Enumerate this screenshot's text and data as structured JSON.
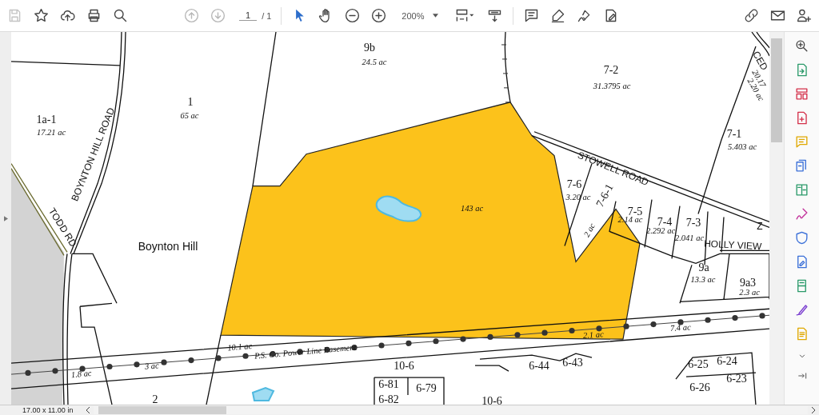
{
  "toolbar": {
    "page_number": "1",
    "page_total": "/ 1",
    "zoom": "200%"
  },
  "map": {
    "labels": [
      {
        "text": "9b",
        "kind": "parcel"
      },
      {
        "text": "24.5 ac",
        "kind": "area"
      },
      {
        "text": "7-2",
        "kind": "parcel"
      },
      {
        "text": "31.3795 ac",
        "kind": "area"
      },
      {
        "text": "CED",
        "kind": "road"
      },
      {
        "text": "20.17",
        "kind": "area"
      },
      {
        "text": "2.20 ac",
        "kind": "area"
      },
      {
        "text": "1a-1",
        "kind": "parcel"
      },
      {
        "text": "17.21 ac",
        "kind": "area"
      },
      {
        "text": "1",
        "kind": "parcel"
      },
      {
        "text": "65 ac",
        "kind": "area"
      },
      {
        "text": "7-1",
        "kind": "parcel"
      },
      {
        "text": "5.403 ac",
        "kind": "area"
      },
      {
        "text": "BOYNTON HILL ROAD",
        "kind": "road"
      },
      {
        "text": "STOWELL ROAD",
        "kind": "road"
      },
      {
        "text": "7-6",
        "kind": "parcel"
      },
      {
        "text": "3.20 ac",
        "kind": "area"
      },
      {
        "text": "7-6-1",
        "kind": "parcel"
      },
      {
        "text": "143 ac",
        "kind": "area"
      },
      {
        "text": "7-5",
        "kind": "parcel"
      },
      {
        "text": "2.14 ac",
        "kind": "area"
      },
      {
        "text": "7-4",
        "kind": "parcel"
      },
      {
        "text": "2.292 ac",
        "kind": "area"
      },
      {
        "text": "7-3",
        "kind": "parcel"
      },
      {
        "text": "2.041 ac",
        "kind": "area"
      },
      {
        "text": "Z",
        "kind": "road"
      },
      {
        "text": "2 ac",
        "kind": "area"
      },
      {
        "text": "TODD RD",
        "kind": "road"
      },
      {
        "text": "Boynton Hill",
        "kind": "place"
      },
      {
        "text": "HOLLY VIEW",
        "kind": "road"
      },
      {
        "text": "9a",
        "kind": "parcel"
      },
      {
        "text": "13.3 ac",
        "kind": "area"
      },
      {
        "text": "9a3",
        "kind": "parcel"
      },
      {
        "text": "2.3 ac",
        "kind": "area"
      },
      {
        "text": "7.4 ac",
        "kind": "area"
      },
      {
        "text": "2.1 ac",
        "kind": "area"
      },
      {
        "text": "10.1 ac",
        "kind": "area"
      },
      {
        "text": "P.S. Co. Power Line Easement",
        "kind": "area"
      },
      {
        "text": "3 ac",
        "kind": "area"
      },
      {
        "text": "1.8 ac",
        "kind": "area"
      },
      {
        "text": "10-6",
        "kind": "parcel"
      },
      {
        "text": "6-44",
        "kind": "parcel"
      },
      {
        "text": "6-43",
        "kind": "parcel"
      },
      {
        "text": "6-25",
        "kind": "parcel"
      },
      {
        "text": "6-24",
        "kind": "parcel"
      },
      {
        "text": "6-81",
        "kind": "parcel"
      },
      {
        "text": "6-79",
        "kind": "parcel"
      },
      {
        "text": "6-26",
        "kind": "parcel"
      },
      {
        "text": "6-23",
        "kind": "parcel"
      },
      {
        "text": "2",
        "kind": "parcel"
      },
      {
        "text": "6-82",
        "kind": "parcel"
      },
      {
        "text": "10-6",
        "kind": "parcel"
      }
    ]
  },
  "status_bar": {
    "page_size": "17.00 x 11.00 in"
  }
}
